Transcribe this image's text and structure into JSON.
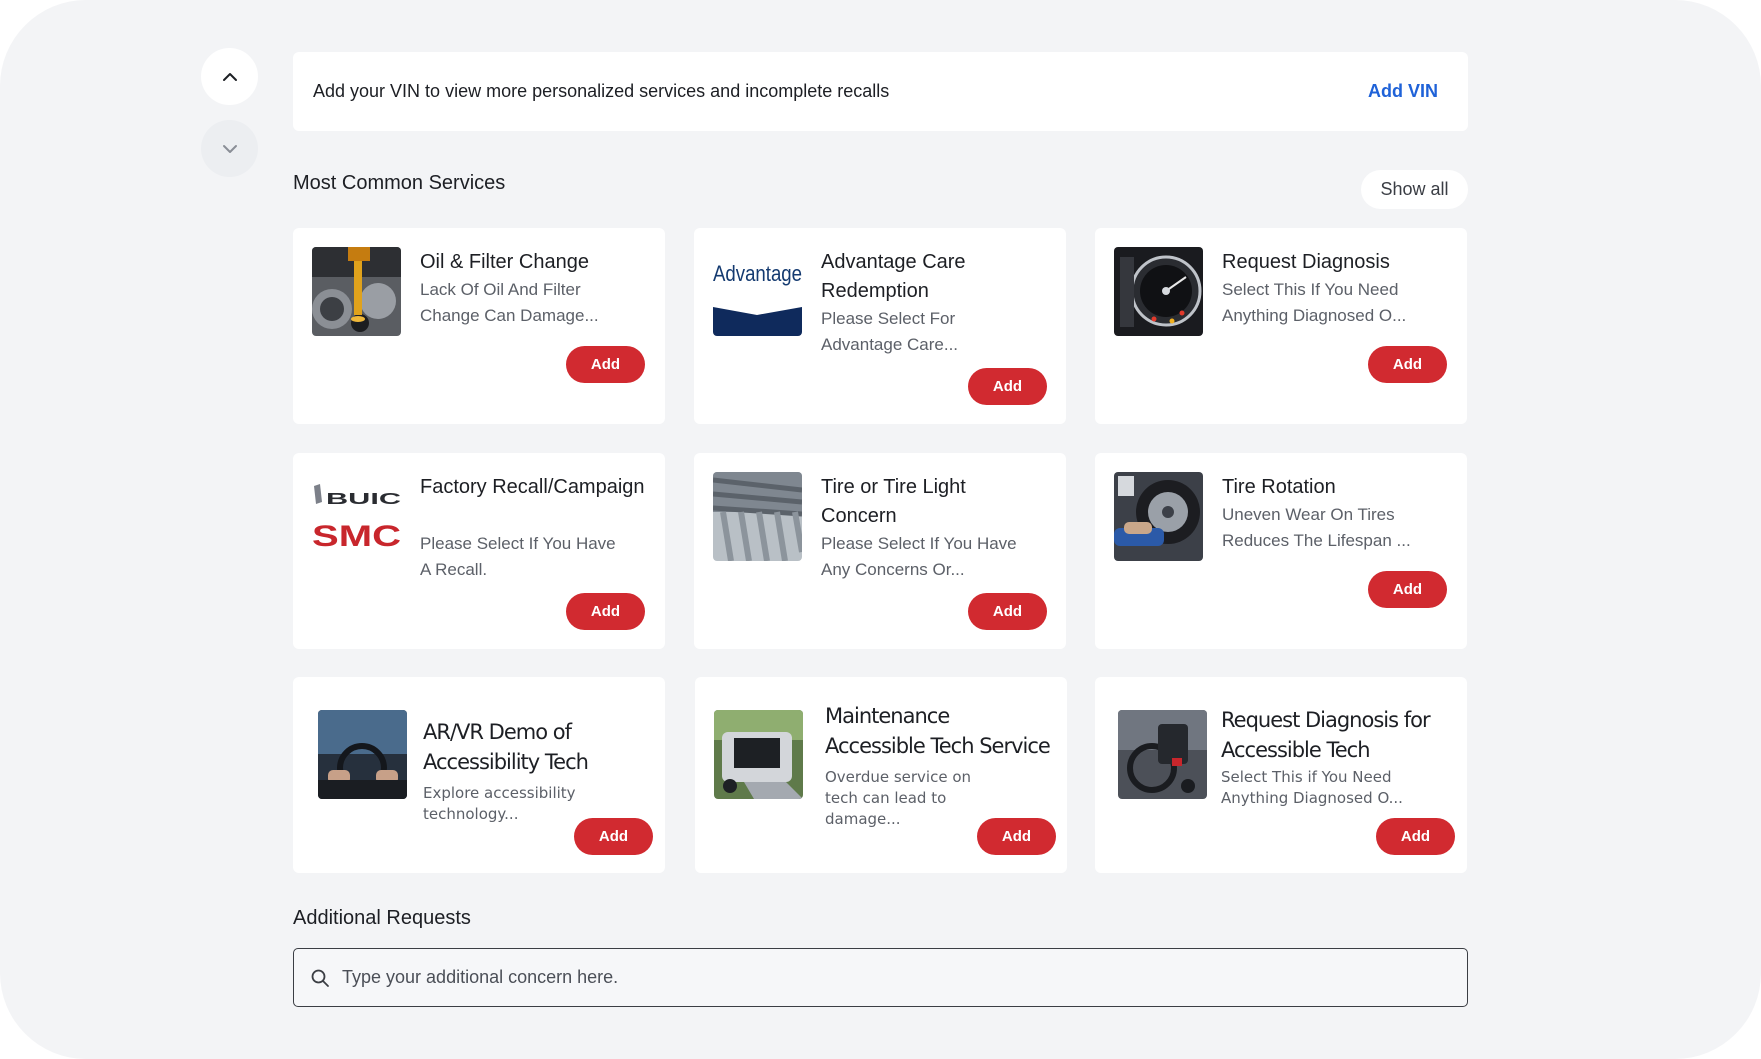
{
  "nav": {
    "up_icon": "chevron-up-icon",
    "down_icon": "chevron-down-icon"
  },
  "vin_banner": {
    "text": "Add your VIN to view more personalized services and incomplete recalls",
    "link": "Add VIN"
  },
  "common_services": {
    "title": "Most Common Services",
    "show_all": "Show all",
    "cards": [
      {
        "title": "Oil & Filter Change",
        "desc": "Lack Of Oil And Filter Change Can Damage...",
        "button": "Add"
      },
      {
        "title": "Advantage Care Redemption",
        "desc": "Please Select For Advantage Care...",
        "button": "Add",
        "logo_text": "Advantage"
      },
      {
        "title": "Request Diagnosis",
        "desc": "Select This If You Need Anything Diagnosed O...",
        "button": "Add"
      },
      {
        "title": "Factory Recall/Campaign",
        "desc": "Please Select If You Have A Recall.",
        "button": "Add",
        "logo_text_1": "BUIC",
        "logo_text_2": "SMC"
      },
      {
        "title": "Tire or Tire Light Concern",
        "desc": "Please Select If You Have Any Concerns Or...",
        "button": "Add"
      },
      {
        "title": "Tire Rotation",
        "desc": "Uneven Wear On Tires Reduces The Lifespan ...",
        "button": "Add"
      },
      {
        "title": "AR/VR Demo of Accessibility Tech",
        "desc": "Explore accessibility technology...",
        "button": "Add"
      },
      {
        "title": "Maintenance Accessible Tech Service",
        "desc": "Overdue service on tech can lead to damage...",
        "button": "Add"
      },
      {
        "title": "Request Diagnosis for Accessible Tech",
        "desc": "Select This if You Need Anything Diagnosed O...",
        "button": "Add"
      }
    ]
  },
  "additional": {
    "title": "Additional Requests",
    "placeholder": "Type your additional concern here.",
    "icon": "search-icon"
  },
  "colors": {
    "accent_red": "#d12a30",
    "link_blue": "#1f62d8",
    "background": "#f3f4f6"
  }
}
